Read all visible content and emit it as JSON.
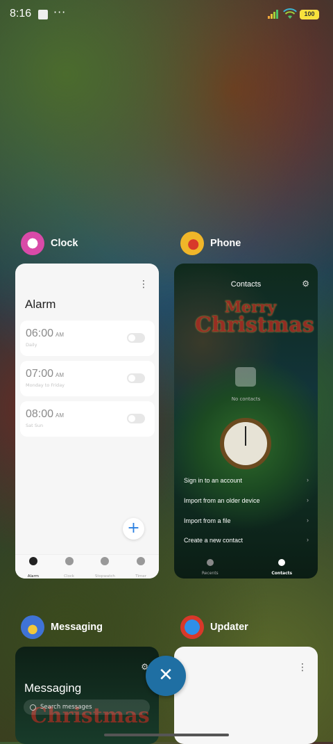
{
  "status_bar": {
    "time": "8:16",
    "more": "···",
    "battery": "100"
  },
  "apps": [
    {
      "name": "Clock",
      "icon": "clock-app-icon",
      "screen": {
        "title": "Alarm",
        "alarms": [
          {
            "time": "06:00",
            "ampm": "AM",
            "repeat": "Daily"
          },
          {
            "time": "07:00",
            "ampm": "AM",
            "repeat": "Monday to Friday"
          },
          {
            "time": "08:00",
            "ampm": "AM",
            "repeat": "Sat Sun"
          }
        ],
        "tabs": [
          "Alarm",
          "Clock",
          "Stopwatch",
          "Timer"
        ]
      }
    },
    {
      "name": "Phone",
      "icon": "phone-app-icon",
      "screen": {
        "title": "Contacts",
        "banner_line1": "Merry",
        "banner_line2": "Christmas",
        "empty_text": "No contacts",
        "actions": [
          "Sign in to an account",
          "Import from an older device",
          "Import from a file",
          "Create a new contact"
        ],
        "tabs": [
          "Recents",
          "Contacts"
        ]
      }
    },
    {
      "name": "Messaging",
      "icon": "messaging-app-icon",
      "screen": {
        "title": "Messaging",
        "search_placeholder": "Search messages",
        "banner": "Christmas"
      }
    },
    {
      "name": "Updater",
      "icon": "updater-app-icon",
      "screen": {}
    }
  ],
  "controls": {
    "close_all": "✕",
    "menu": "⋮",
    "add": "+",
    "chevron": "›",
    "settings": "⚙"
  },
  "colors": {
    "accent": "#1f6fa3",
    "fab_plus": "#2a7fe0",
    "xmas_red": "#b22d22"
  }
}
